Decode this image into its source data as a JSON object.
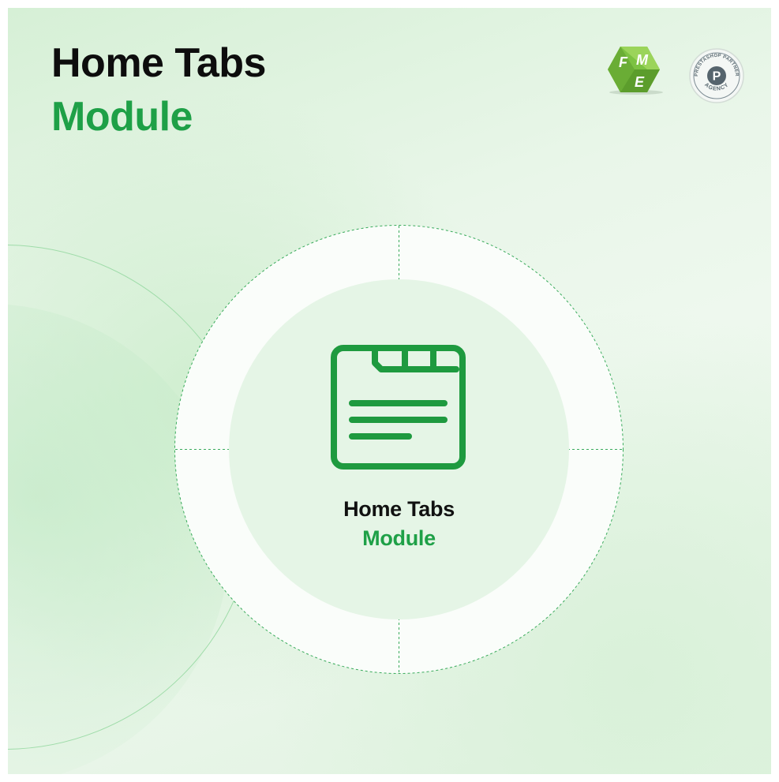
{
  "header": {
    "title_line1": "Home Tabs",
    "title_line2": "Module"
  },
  "logos": {
    "brand": {
      "icon": "fme-cube-logo-icon",
      "letters": [
        "F",
        "M",
        "E"
      ]
    },
    "partner_badge": {
      "icon": "prestashop-partner-badge-icon",
      "arc_top_text": "PRESTASHOP PARTNER",
      "arc_bottom_text": "AGENCY",
      "center_letter": "P"
    }
  },
  "center": {
    "icon": "home-tabs-window-icon",
    "label_line1": "Home Tabs",
    "label_line2": "Module"
  },
  "colors": {
    "accent_green": "#1ea047",
    "icon_green": "#1e9a3f",
    "title_black": "#0d0d0d",
    "background_mint": "#e5f5e6"
  }
}
